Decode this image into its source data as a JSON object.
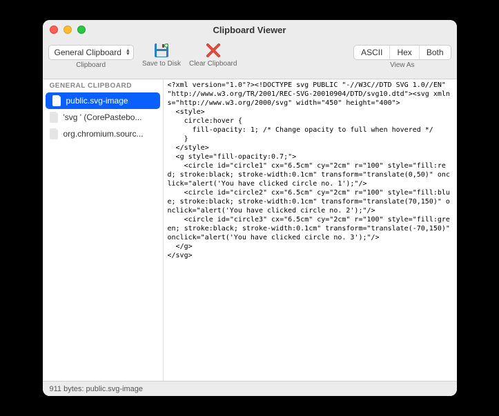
{
  "window": {
    "title": "Clipboard Viewer"
  },
  "toolbar": {
    "clipboard": {
      "label": "Clipboard",
      "selected": "General Clipboard"
    },
    "save": {
      "label": "Save to Disk"
    },
    "clear": {
      "label": "Clear Clipboard"
    },
    "viewas": {
      "label": "View As",
      "options": {
        "ascii": "ASCII",
        "hex": "Hex",
        "both": "Both"
      }
    }
  },
  "sidebar": {
    "header": "GENERAL CLIPBOARD",
    "items": [
      {
        "label": "public.svg-image",
        "selected": true
      },
      {
        "label": "'svg ' (CorePastebo...",
        "selected": false
      },
      {
        "label": "org.chromium.sourc...",
        "selected": false
      }
    ]
  },
  "content": "<?xml version=\"1.0\"?><!DOCTYPE svg PUBLIC \"-//W3C//DTD SVG 1.0//EN\" \"http://www.w3.org/TR/2001/REC-SVG-20010904/DTD/svg10.dtd\"><svg xmlns=\"http://www.w3.org/2000/svg\" width=\"450\" height=\"400\">\n  <style>\n    circle:hover {\n      fill-opacity: 1; /* Change opacity to full when hovered */\n    }\n  </style>\n  <g style=\"fill-opacity:0.7;\">\n    <circle id=\"circle1\" cx=\"6.5cm\" cy=\"2cm\" r=\"100\" style=\"fill:red; stroke:black; stroke-width:0.1cm\" transform=\"translate(0,50)\" onclick=\"alert('You have clicked circle no. 1');\"/>\n    <circle id=\"circle2\" cx=\"6.5cm\" cy=\"2cm\" r=\"100\" style=\"fill:blue; stroke:black; stroke-width:0.1cm\" transform=\"translate(70,150)\" onclick=\"alert('You have clicked circle no. 2');\"/>\n    <circle id=\"circle3\" cx=\"6.5cm\" cy=\"2cm\" r=\"100\" style=\"fill:green; stroke:black; stroke-width:0.1cm\" transform=\"translate(-70,150)\" onclick=\"alert('You have clicked circle no. 3');\"/>\n  </g>\n</svg>",
  "statusbar": {
    "text": "911 bytes: public.svg-image"
  }
}
